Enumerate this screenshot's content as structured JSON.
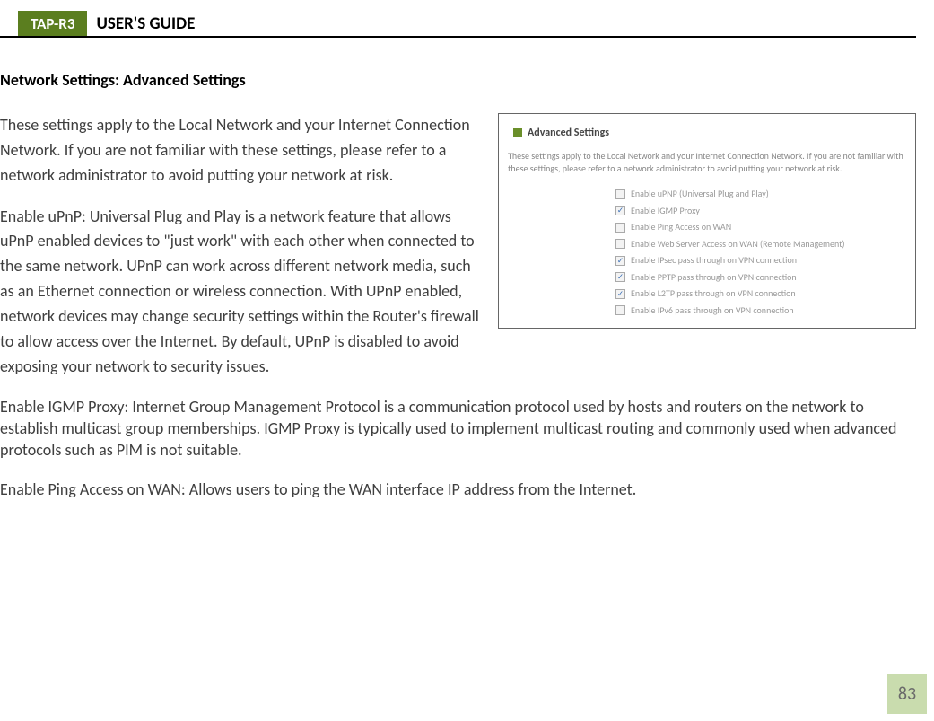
{
  "header": {
    "model": "TAP-R3",
    "title": "USER'S GUIDE"
  },
  "section_title": "Network Settings: Advanced Settings",
  "paragraphs": {
    "p1": "These settings apply to the Local Network and your Internet Connection Network.  If you are not familiar with these settings, please refer to a network administrator to avoid putting your network at risk.",
    "p2": "Enable uPnP: Universal Plug and Play is a network feature that allows uPnP enabled devices to \"just work\" with each other when connected to the same network.  UPnP can work across different network media, such as an Ethernet connection or wireless connection.  With UPnP enabled, network devices may change security settings within the Router's firewall to allow access over the Internet.  By default, UPnP is disabled to avoid exposing your network to security issues.",
    "p3": "Enable IGMP Proxy: Internet Group Management Protocol is a communication protocol used by hosts and routers on the network to establish multicast group memberships.  IGMP Proxy is typically used to implement multicast routing and commonly used when advanced protocols such as PIM is not suitable.",
    "p4": "Enable Ping Access on WAN: Allows users to ping the WAN interface IP address from the Internet."
  },
  "screenshot": {
    "title": "Advanced Settings",
    "desc": "These settings apply to the Local Network and your Internet Connection Network.  If you are not familiar with these settings, please refer to a network administrator to avoid putting your network at risk.",
    "options": [
      {
        "label": "Enable uPNP (Universal Plug and Play)",
        "checked": false
      },
      {
        "label": "Enable IGMP Proxy",
        "checked": true
      },
      {
        "label": "Enable Ping Access on WAN",
        "checked": false
      },
      {
        "label": "Enable Web Server Access on WAN (Remote Management)",
        "checked": false
      },
      {
        "label": "Enable IPsec pass through on VPN connection",
        "checked": true
      },
      {
        "label": "Enable PPTP pass through on VPN connection",
        "checked": true
      },
      {
        "label": "Enable L2TP pass through on VPN connection",
        "checked": true
      },
      {
        "label": "Enable IPv6 pass through on VPN connection",
        "checked": false
      }
    ]
  },
  "page_number": "83"
}
